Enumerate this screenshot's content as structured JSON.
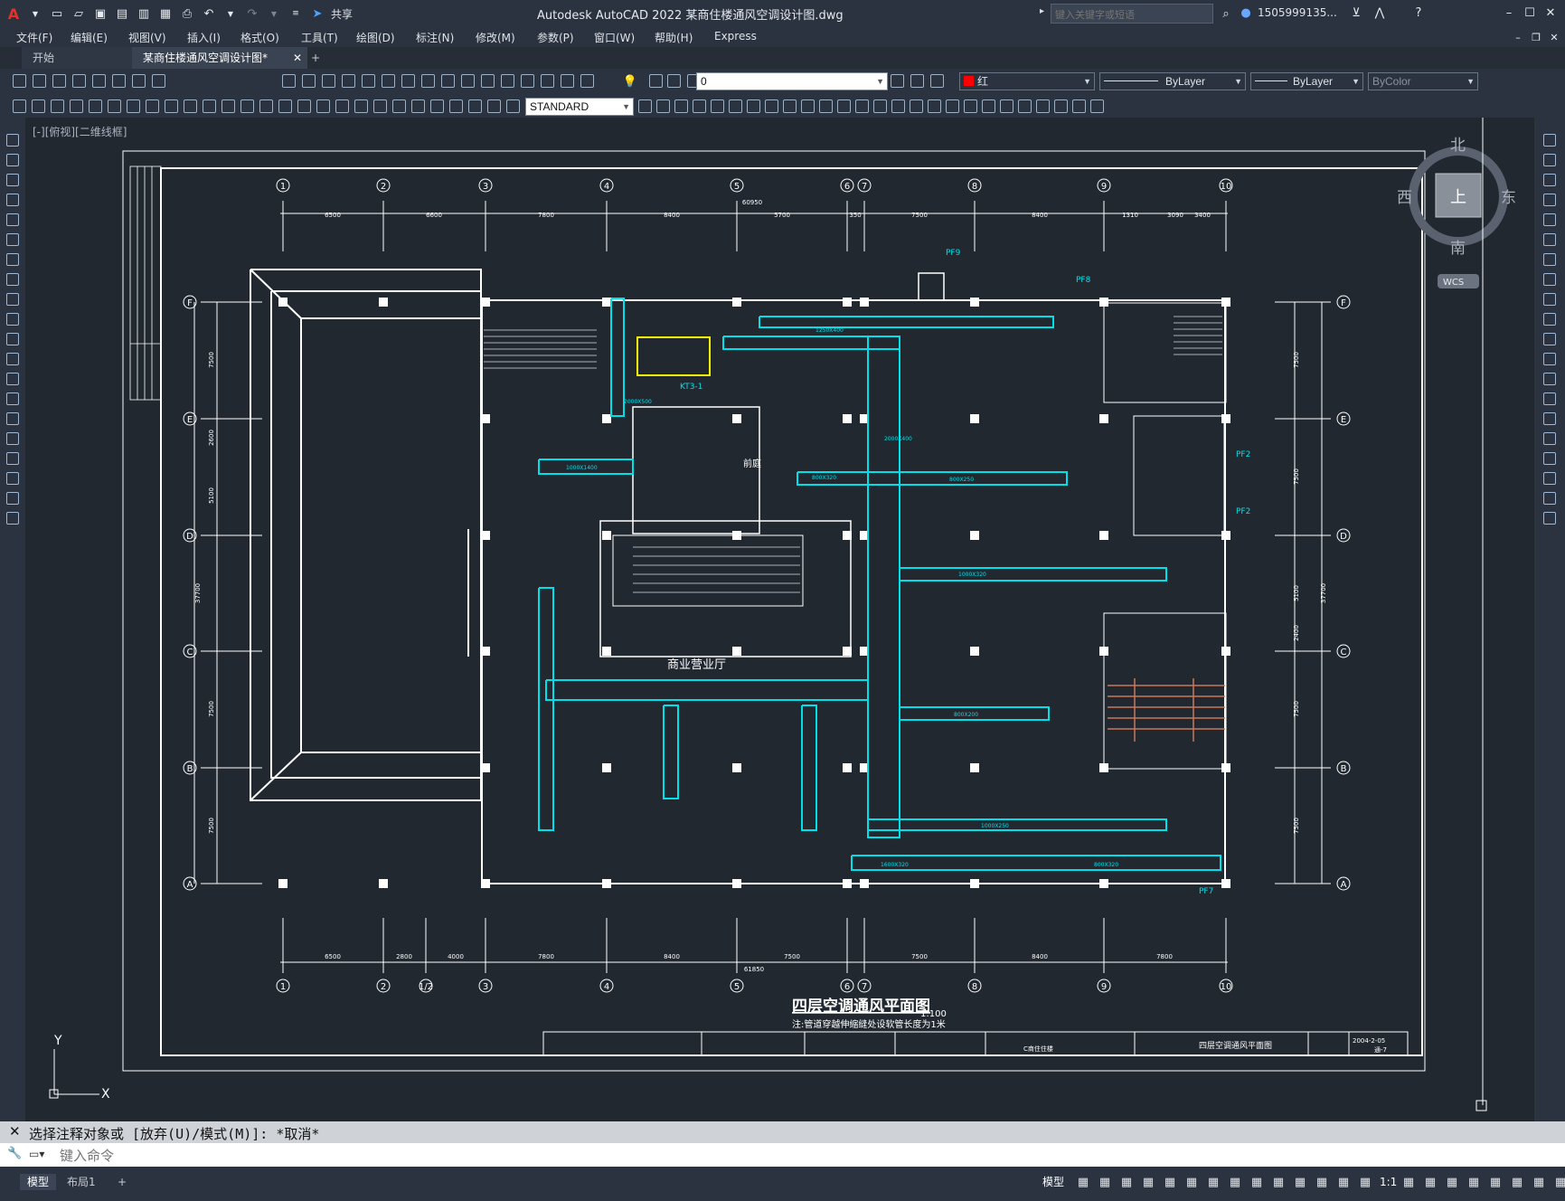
{
  "app": {
    "title": "Autodesk AutoCAD 2022    某商住楼通风空调设计图.dwg",
    "search_placeholder": "键入关键字或短语",
    "user": "1505999135...",
    "share_label": "共享"
  },
  "menu": [
    "文件(F)",
    "编辑(E)",
    "视图(V)",
    "插入(I)",
    "格式(O)",
    "工具(T)",
    "绘图(D)",
    "标注(N)",
    "修改(M)",
    "参数(P)",
    "窗口(W)",
    "帮助(H)",
    "Express"
  ],
  "tabs": {
    "start": "开始",
    "doc": "某商住楼通风空调设计图*",
    "add": "+"
  },
  "properties": {
    "layer": "0",
    "color": "红",
    "linetype": "ByLayer",
    "lineweight": "ByLayer",
    "plotstyle": "ByColor",
    "textstyle": "STANDARD"
  },
  "viewport_label": "[-][俯视][二维线框]",
  "viewcube": {
    "north": "北",
    "south": "南",
    "east": "东",
    "west": "西",
    "top": "上",
    "wcs": "WCS"
  },
  "drawing": {
    "title": "四层空调通风平面图",
    "scale": "1:100",
    "note": "注:管道穿越伸缩缝处设软管长度为1米",
    "axes_top": [
      "1",
      "2",
      "3",
      "4",
      "5",
      "6",
      "7",
      "8",
      "9",
      "10"
    ],
    "axes_bottom": [
      "1",
      "2",
      "1/2",
      "3",
      "4",
      "5",
      "6",
      "7",
      "8",
      "9",
      "10"
    ],
    "axes_side": [
      "F",
      "E",
      "D",
      "C",
      "B",
      "A"
    ],
    "dims_top": [
      "6500",
      "6600",
      "7800",
      "8400",
      "5700",
      "350",
      "7500",
      "8400",
      "1310",
      "3090",
      "3400"
    ],
    "dims_bottom": [
      "6500",
      "2800",
      "4000",
      "7800",
      "8400",
      "7500",
      "7500",
      "8400",
      "7800"
    ],
    "dims_left": [
      "7500",
      "2600",
      "5100",
      "7500",
      "7500"
    ],
    "dims_right": [
      "7500",
      "7500",
      "5100",
      "2400",
      "7500",
      "7500"
    ],
    "total_bottom": "61850",
    "total_top": "60950",
    "total_left": "37700",
    "total_right": "37700",
    "room_labels": [
      "商业营业厅",
      "前庭"
    ],
    "equip_labels": [
      "KT3-1",
      "PF9",
      "PF8",
      "PF2",
      "PF2",
      "PF7"
    ],
    "duct_labels": [
      "1250X400",
      "2000X500",
      "1000X1400",
      "2000X400",
      "800X320",
      "800X250",
      "1000X320",
      "800X200",
      "1000X250",
      "1600X320",
      "800X320"
    ],
    "titleblock": {
      "name": "四层空调通风平面图",
      "project": "C商住住楼",
      "date": "2004-2-05",
      "sheet": "通-7"
    }
  },
  "command": {
    "history": "选择注释对象或 [放弃(U)/模式(M)]: *取消*",
    "prompt_placeholder": "键入命令"
  },
  "status": {
    "model_tab": "模型",
    "layout_tab": "布局1",
    "model_btn": "模型",
    "scale": "1:1"
  }
}
